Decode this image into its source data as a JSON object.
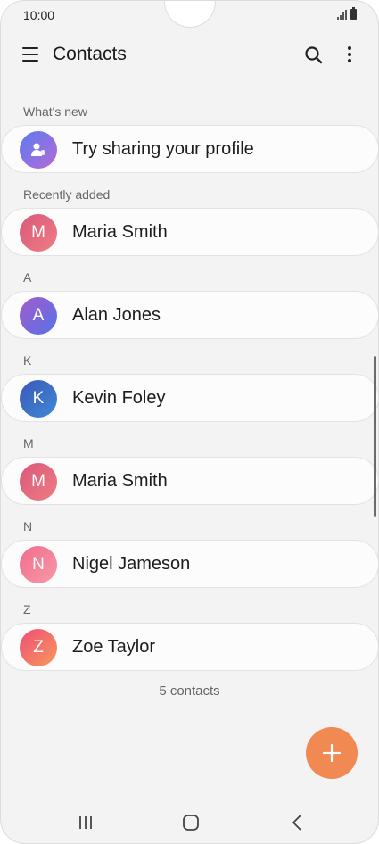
{
  "status_bar": {
    "time": "10:00"
  },
  "app_bar": {
    "title": "Contacts"
  },
  "sections": {
    "whats_new": "What's new",
    "recently_added": "Recently added",
    "a": "A",
    "k": "K",
    "m": "M",
    "n": "N",
    "z": "Z"
  },
  "profile_card": {
    "label": "Try sharing your profile"
  },
  "contacts": [
    {
      "initial": "M",
      "name": "Maria Smith",
      "avatar_color": "#e2607a"
    },
    {
      "initial": "A",
      "name": "Alan Jones",
      "avatar_color": "#7b61d9"
    },
    {
      "initial": "K",
      "name": "Kevin Foley",
      "avatar_color": "#3f6fc6"
    },
    {
      "initial": "M",
      "name": "Maria Smith",
      "avatar_color": "#e2607a"
    },
    {
      "initial": "N",
      "name": "Nigel Jameson",
      "avatar_color": "#f07a94"
    },
    {
      "initial": "Z",
      "name": "Zoe Taylor",
      "avatar_color": "#f26072"
    }
  ],
  "footer": {
    "count": "5 contacts"
  },
  "colors": {
    "fab": "#f08a52",
    "background": "#f3f3f3"
  },
  "icons": {
    "menu": "hamburger-menu-icon",
    "search": "search-icon",
    "more": "more-vertical-icon",
    "add": "plus-icon",
    "profile": "person-share-icon"
  }
}
